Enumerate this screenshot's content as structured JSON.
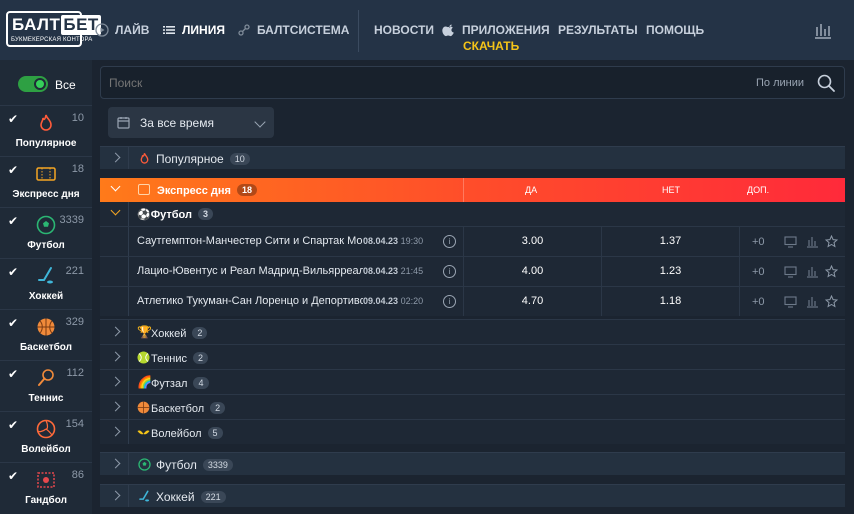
{
  "header": {
    "logo_main": "БАЛТ",
    "logo_bet": "БЕТ",
    "logo_sub": "БУКМЕКЕРСКАЯ КОНТОРА",
    "nav": [
      {
        "label": "ЛАЙВ",
        "icon": "play-icon"
      },
      {
        "label": "ЛИНИЯ",
        "icon": "list-icon",
        "active": true
      },
      {
        "label": "БАЛТСИСТЕМА",
        "icon": "network-icon"
      },
      {
        "label": "НОВОСТИ"
      },
      {
        "label": "ПРИЛОЖЕНИЯ",
        "icon": "apple-icon"
      },
      {
        "label": "РЕЗУЛЬТАТЫ"
      },
      {
        "label": "ПОМОЩЬ"
      }
    ],
    "download_label": "СКАЧАТЬ",
    "accent": "#f5c518"
  },
  "sidebar": {
    "toggle_label": "Все",
    "items": [
      {
        "name": "Популярное",
        "count": "10",
        "color": "#ff5b3a"
      },
      {
        "name": "Экспресс дня",
        "count": "18",
        "color": "#f5a623"
      },
      {
        "name": "Футбол",
        "count": "3339",
        "color": "#2bb673"
      },
      {
        "name": "Хоккей",
        "count": "221",
        "color": "#3fb6d9"
      },
      {
        "name": "Баскетбол",
        "count": "329",
        "color": "#f08a3a"
      },
      {
        "name": "Теннис",
        "count": "112",
        "color": "#f08a3a"
      },
      {
        "name": "Волейбол",
        "count": "154",
        "color": "#ff6a3a"
      },
      {
        "name": "Гандбол",
        "count": "86",
        "color": "#e5484d"
      }
    ]
  },
  "search": {
    "placeholder": "Поиск",
    "scope": "По линии"
  },
  "period": {
    "label": "За все время"
  },
  "popular_row": {
    "label": "Популярное",
    "count": "10"
  },
  "express": {
    "label": "Экспресс дня",
    "count": "18",
    "col_yes": "ДА",
    "col_no": "НЕТ",
    "col_more": "ДОП."
  },
  "football_group": {
    "label": "Футбол",
    "count": "3"
  },
  "events": [
    {
      "name": "Саутгемптон-Манчестер Сити и Спартак Москва",
      "date": "08.04.23",
      "time": "19:30",
      "yes": "3.00",
      "no": "1.37",
      "more": "+0"
    },
    {
      "name": "Лацио-Ювентус и Реал Мадрид-Вильярреал",
      "date": "08.04.23",
      "time": "21:45",
      "yes": "4.00",
      "no": "1.23",
      "more": "+0"
    },
    {
      "name": "Атлетико Тукуман-Сан Лоренцо и Депортиво",
      "date": "09.04.23",
      "time": "02:20",
      "yes": "4.70",
      "no": "1.18",
      "more": "+0"
    }
  ],
  "sub_groups": [
    {
      "label": "Хоккей",
      "count": "2",
      "icon": "trophy-icon"
    },
    {
      "label": "Теннис",
      "count": "2",
      "icon": "tennis-ball-icon"
    },
    {
      "label": "Футзал",
      "count": "4",
      "icon": "rainbow-icon"
    },
    {
      "label": "Баскетбол",
      "count": "2",
      "icon": "basketball-icon"
    },
    {
      "label": "Волейбол",
      "count": "5",
      "icon": "wings-icon"
    }
  ],
  "bottom_rows": [
    {
      "label": "Футбол",
      "count": "3339"
    },
    {
      "label": "Хоккей",
      "count": "221"
    }
  ]
}
